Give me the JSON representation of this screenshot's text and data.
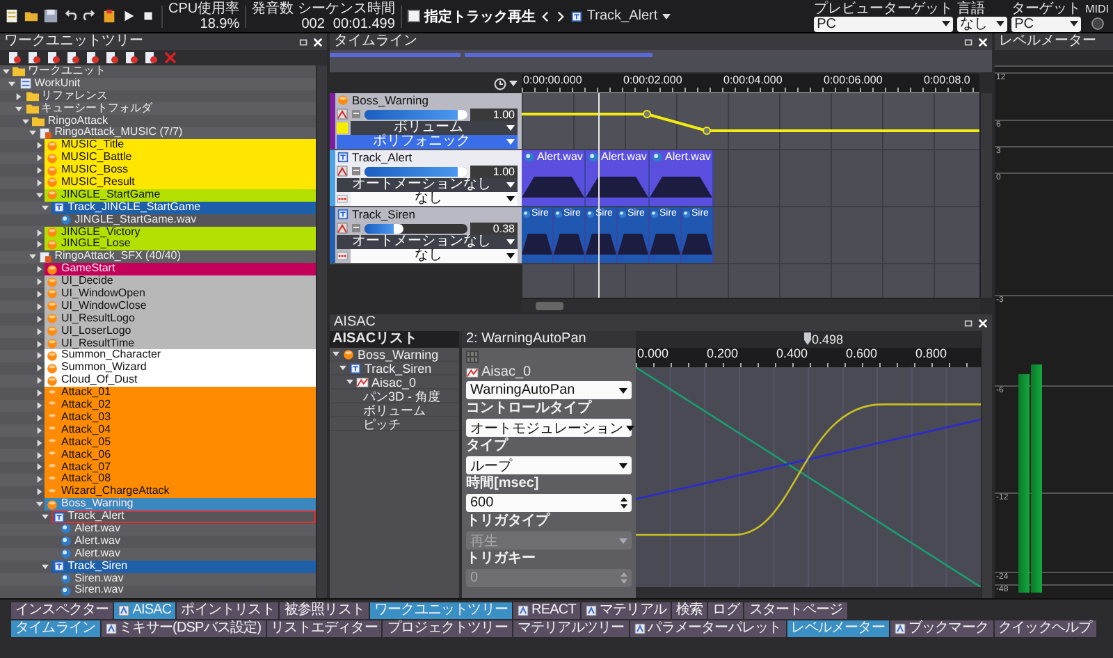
{
  "toolbar": {
    "cpu_label": "CPU使用率",
    "cpu_value": "18.9%",
    "voices_label": "発音数 シーケンス時間",
    "voice_count": "002",
    "sequence_time": "00:01.499",
    "solo_track": {
      "label": "指定トラック再生",
      "checked": false
    },
    "current_track": "Track_Alert",
    "selectors": [
      {
        "label": "プレビューターゲット",
        "value": "PC"
      },
      {
        "label": "言語",
        "value": "なし"
      },
      {
        "label": "ターゲット",
        "value": "PC"
      }
    ],
    "midi_label": "MIDI"
  },
  "worktree": {
    "title": "ワークユニットツリー",
    "items": [
      {
        "label": "ワークユニット",
        "kind": "folder",
        "expanded": true,
        "selected": false,
        "focused": false,
        "children": [
          {
            "label": "WorkUnit",
            "kind": "workunit",
            "expanded": true,
            "selected": false,
            "focused": false,
            "children": [
              {
                "label": "リファレンス",
                "kind": "folder",
                "expanded": false,
                "selected": false,
                "focused": false
              },
              {
                "label": "キューシートフォルダ",
                "kind": "folder",
                "expanded": true,
                "selected": false,
                "focused": false,
                "children": [
                  {
                    "label": "RingoAttack",
                    "kind": "folder",
                    "expanded": true,
                    "selected": false,
                    "focused": false,
                    "children": [
                      {
                        "label": "RingoAttack_MUSIC (7/7)",
                        "kind": "cuesheet",
                        "expanded": true,
                        "selected": false,
                        "focused": false,
                        "children": [
                          {
                            "label": "MUSIC_Title",
                            "kind": "cue",
                            "expanded": false,
                            "selected": false,
                            "focused": false,
                            "color": "#ffe600"
                          },
                          {
                            "label": "MUSIC_Battle",
                            "kind": "cue",
                            "expanded": false,
                            "selected": false,
                            "focused": false,
                            "color": "#ffe600"
                          },
                          {
                            "label": "MUSIC_Boss",
                            "kind": "cue",
                            "expanded": false,
                            "selected": false,
                            "focused": false,
                            "color": "#ffe600"
                          },
                          {
                            "label": "MUSIC_Result",
                            "kind": "cue",
                            "expanded": false,
                            "selected": false,
                            "focused": false,
                            "color": "#ffe600"
                          },
                          {
                            "label": "JINGLE_StartGame",
                            "kind": "cue",
                            "expanded": true,
                            "selected": false,
                            "focused": false,
                            "color": "#b4e000",
                            "children": [
                              {
                                "label": "Track_JINGLE_StartGame",
                                "kind": "track",
                                "expanded": true,
                                "selected": true,
                                "focused": false,
                                "children": [
                                  {
                                    "label": "JINGLE_StartGame.wav",
                                    "kind": "wave",
                                    "selected": false,
                                    "focused": false
                                  }
                                ]
                              }
                            ]
                          },
                          {
                            "label": "JINGLE_Victory",
                            "kind": "cue",
                            "expanded": false,
                            "selected": false,
                            "focused": false,
                            "color": "#b4e000"
                          },
                          {
                            "label": "JINGLE_Lose",
                            "kind": "cue",
                            "expanded": false,
                            "selected": false,
                            "focused": false,
                            "color": "#b4e000"
                          }
                        ]
                      },
                      {
                        "label": "RingoAttack_SFX (40/40)",
                        "kind": "cuesheet",
                        "expanded": true,
                        "selected": false,
                        "focused": false,
                        "children": [
                          {
                            "label": "GameStart",
                            "kind": "cue",
                            "expanded": false,
                            "selected": false,
                            "focused": false,
                            "color": "#c4005a"
                          },
                          {
                            "label": "UI_Decide",
                            "kind": "cue",
                            "expanded": false,
                            "selected": false,
                            "focused": false,
                            "color": "#b8b8b8"
                          },
                          {
                            "label": "UI_WindowOpen",
                            "kind": "cue",
                            "expanded": false,
                            "selected": false,
                            "focused": false,
                            "color": "#b8b8b8"
                          },
                          {
                            "label": "UI_WindowClose",
                            "kind": "cue",
                            "expanded": false,
                            "selected": false,
                            "focused": false,
                            "color": "#b8b8b8"
                          },
                          {
                            "label": "UI_ResultLogo",
                            "kind": "cue",
                            "expanded": false,
                            "selected": false,
                            "focused": false,
                            "color": "#b8b8b8"
                          },
                          {
                            "label": "UI_LoserLogo",
                            "kind": "cue",
                            "expanded": false,
                            "selected": false,
                            "focused": false,
                            "color": "#b8b8b8"
                          },
                          {
                            "label": "UI_ResultTime",
                            "kind": "cue",
                            "expanded": false,
                            "selected": false,
                            "focused": false,
                            "color": "#b8b8b8"
                          },
                          {
                            "label": "Summon_Character",
                            "kind": "cue",
                            "expanded": false,
                            "selected": false,
                            "focused": false,
                            "color": "#ffffff"
                          },
                          {
                            "label": "Summon_Wizard",
                            "kind": "cue",
                            "expanded": false,
                            "selected": false,
                            "focused": false,
                            "color": "#ffffff"
                          },
                          {
                            "label": "Cloud_Of_Dust",
                            "kind": "cue",
                            "expanded": false,
                            "selected": false,
                            "focused": false,
                            "color": "#ffffff"
                          },
                          {
                            "label": "Attack_01",
                            "kind": "cue",
                            "expanded": false,
                            "selected": false,
                            "focused": false,
                            "color": "#ff8c00"
                          },
                          {
                            "label": "Attack_02",
                            "kind": "cue",
                            "expanded": false,
                            "selected": false,
                            "focused": false,
                            "color": "#ff8c00"
                          },
                          {
                            "label": "Attack_03",
                            "kind": "cue",
                            "expanded": false,
                            "selected": false,
                            "focused": false,
                            "color": "#ff8c00"
                          },
                          {
                            "label": "Attack_04",
                            "kind": "cue",
                            "expanded": false,
                            "selected": false,
                            "focused": false,
                            "color": "#ff8c00"
                          },
                          {
                            "label": "Attack_05",
                            "kind": "cue",
                            "expanded": false,
                            "selected": false,
                            "focused": false,
                            "color": "#ff8c00"
                          },
                          {
                            "label": "Attack_06",
                            "kind": "cue",
                            "expanded": false,
                            "selected": false,
                            "focused": false,
                            "color": "#ff8c00"
                          },
                          {
                            "label": "Attack_07",
                            "kind": "cue",
                            "expanded": false,
                            "selected": false,
                            "focused": false,
                            "color": "#ff8c00"
                          },
                          {
                            "label": "Attack_08",
                            "kind": "cue",
                            "expanded": false,
                            "selected": false,
                            "focused": false,
                            "color": "#ff8c00"
                          },
                          {
                            "label": "Wizard_ChargeAttack",
                            "kind": "cue",
                            "expanded": false,
                            "selected": false,
                            "focused": false,
                            "color": "#ff8c00"
                          },
                          {
                            "label": "Boss_Warning",
                            "kind": "cue",
                            "expanded": true,
                            "selected": false,
                            "focused": false,
                            "color": "#3a88bd",
                            "children": [
                              {
                                "label": "Track_Alert",
                                "kind": "track",
                                "expanded": true,
                                "selected": false,
                                "focused": true,
                                "children": [
                                  {
                                    "label": "Alert.wav",
                                    "kind": "wave",
                                    "selected": false,
                                    "focused": false
                                  },
                                  {
                                    "label": "Alert.wav",
                                    "kind": "wave",
                                    "selected": false,
                                    "focused": false
                                  },
                                  {
                                    "label": "Alert.wav",
                                    "kind": "wave",
                                    "selected": false,
                                    "focused": false
                                  }
                                ]
                              },
                              {
                                "label": "Track_Siren",
                                "kind": "track",
                                "expanded": true,
                                "selected": true,
                                "focused": false,
                                "children": [
                                  {
                                    "label": "Siren.wav",
                                    "kind": "wave",
                                    "selected": false,
                                    "focused": false
                                  },
                                  {
                                    "label": "Siren.wav",
                                    "kind": "wave",
                                    "selected": false,
                                    "focused": false
                                  }
                                ]
                              }
                            ]
                          }
                        ]
                      }
                    ]
                  }
                ]
              }
            ]
          }
        ]
      }
    ]
  },
  "timeline": {
    "title": "タイムライン",
    "ruler": [
      "0:00:00.000",
      "0:00:02.000",
      "0:00:04.000",
      "0:00:06.000",
      "0:00:08.0"
    ],
    "tracks": [
      {
        "kind": "cue",
        "name": "Boss_Warning",
        "color": "#7b1fa0",
        "selected": false,
        "level": 1.0,
        "reading": "1.00",
        "parameter": "ボリューム",
        "mode": "ポリフォニック"
      },
      {
        "kind": "track",
        "name": "Track_Alert",
        "color": "#4aa3e6",
        "selected": true,
        "level": 1.0,
        "reading": "1.00",
        "automation": "オートメーションなし",
        "mode": "なし",
        "clips": [
          "Alert.wav",
          "Alert.wav",
          "Alert.wav"
        ]
      },
      {
        "kind": "track",
        "name": "Track_Siren",
        "color": "#1f5fb4",
        "selected": false,
        "level": 0.38,
        "reading": "0.38",
        "automation": "オートメーションなし",
        "mode": "なし",
        "clips": [
          "Sire",
          "Sire",
          "Sire",
          "Sire",
          "Sire",
          "Sire"
        ]
      }
    ]
  },
  "aisac": {
    "title": "AISAC",
    "list_title": "AISACリスト",
    "tree": [
      {
        "label": "Boss_Warning",
        "kind": "cue",
        "expanded": true,
        "children": [
          {
            "label": "Track_Siren",
            "kind": "track",
            "expanded": true,
            "children": [
              {
                "label": "Aisac_0",
                "kind": "aisac",
                "expanded": true,
                "children": [
                  {
                    "label": "パン3D - 角度"
                  },
                  {
                    "label": "ボリューム"
                  },
                  {
                    "label": "ピッチ"
                  }
                ]
              }
            ]
          }
        ]
      }
    ],
    "graph_title": "2: WarningAutoPan",
    "cursor": {
      "level": 0.498,
      "reading": "0.498"
    },
    "ruler": [
      "0.000",
      "0.200",
      "0.400",
      "0.600",
      "0.800"
    ],
    "form": {
      "name": "Aisac_0",
      "fields": [
        {
          "kind": "select",
          "value": "WarningAutoPan",
          "disabled": false
        },
        {
          "kind": "label",
          "text": "コントロールタイプ"
        },
        {
          "kind": "select",
          "value": "オートモジュレーション",
          "disabled": false
        },
        {
          "kind": "label",
          "text": "タイプ"
        },
        {
          "kind": "select",
          "value": "ループ",
          "disabled": false
        },
        {
          "kind": "label",
          "text": "時間[msec]"
        },
        {
          "kind": "spin",
          "value": "600",
          "disabled": false
        },
        {
          "kind": "label",
          "text": "トリガタイプ"
        },
        {
          "kind": "select",
          "value": "再生",
          "disabled": true
        },
        {
          "kind": "label",
          "text": "トリガキー"
        },
        {
          "kind": "spin",
          "value": "0",
          "disabled": true
        }
      ]
    }
  },
  "level_meter": {
    "title": "レベルメーター",
    "scale": [
      "12",
      "6",
      "3",
      "0",
      "-3",
      "-6",
      "-12",
      "-24",
      "-48"
    ],
    "channels": [
      {
        "level": 0.41
      },
      {
        "level": 0.43
      }
    ]
  },
  "dock_tabs": [
    [
      {
        "label": "インスペクター",
        "selected": false,
        "icon": false
      },
      {
        "label": "AISAC",
        "selected": true,
        "icon": true
      },
      {
        "label": "ポイントリスト",
        "selected": false,
        "icon": false
      },
      {
        "label": "被参照リスト",
        "selected": false,
        "icon": false
      },
      {
        "label": "ワークユニットツリー",
        "selected": true,
        "icon": false
      },
      {
        "label": "REACT",
        "selected": false,
        "icon": true
      },
      {
        "label": "マテリアル",
        "selected": false,
        "icon": true
      },
      {
        "label": "検索",
        "selected": false,
        "icon": false
      },
      {
        "label": "ログ",
        "selected": false,
        "icon": false
      },
      {
        "label": "スタートページ",
        "selected": false,
        "icon": false
      }
    ],
    [
      {
        "label": "タイムライン",
        "selected": true,
        "icon": false
      },
      {
        "label": "ミキサー(DSPバス設定)",
        "selected": false,
        "icon": true
      },
      {
        "label": "リストエディター",
        "selected": false,
        "icon": false
      },
      {
        "label": "プロジェクトツリー",
        "selected": false,
        "icon": false
      },
      {
        "label": "マテリアルツリー",
        "selected": false,
        "icon": false
      },
      {
        "label": "パラメーターパレット",
        "selected": false,
        "icon": true
      },
      {
        "label": "レベルメーター",
        "selected": true,
        "icon": false
      },
      {
        "label": "ブックマーク",
        "selected": false,
        "icon": true
      },
      {
        "label": "クイックヘルプ",
        "selected": false,
        "icon": false
      }
    ]
  ]
}
